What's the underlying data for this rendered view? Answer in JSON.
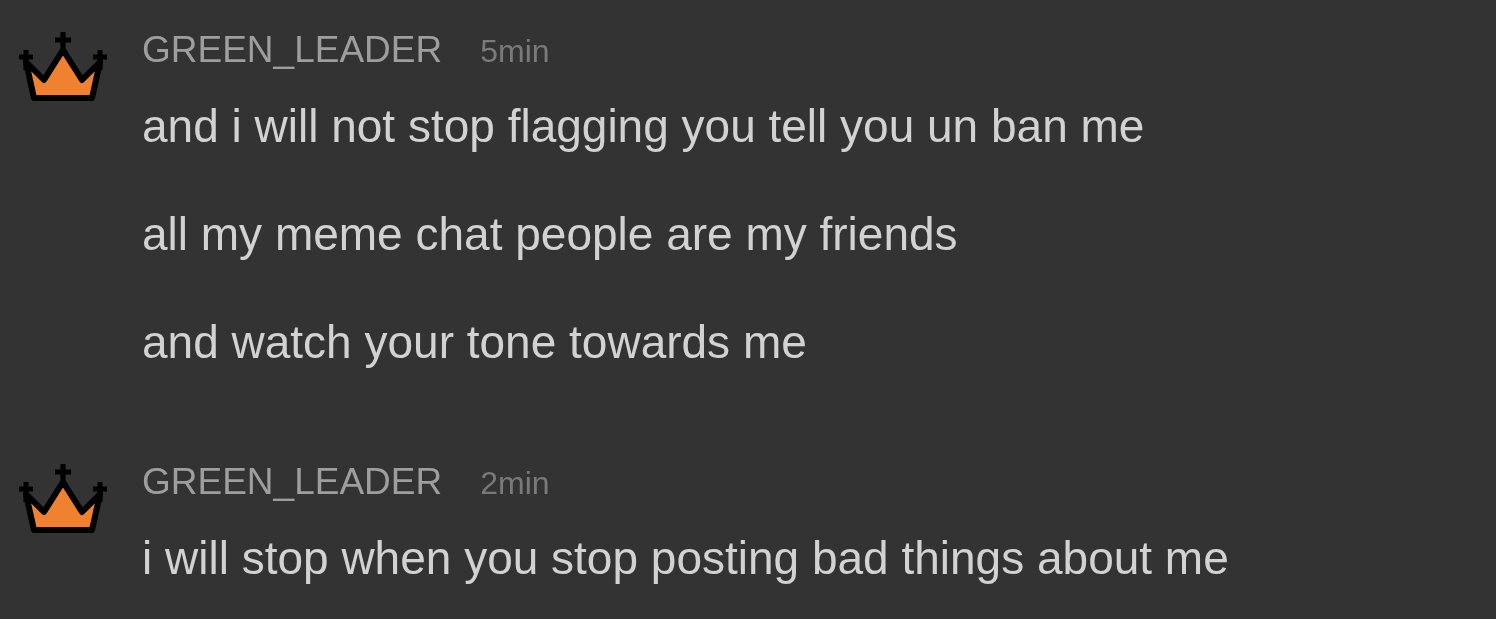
{
  "messages": [
    {
      "author": "GREEN_LEADER",
      "time": "5min",
      "lines": [
        "and i will not stop flagging you tell you un ban me",
        "all my meme chat people are my friends",
        "and watch your tone towards me"
      ]
    },
    {
      "author": "GREEN_LEADER",
      "time": "2min",
      "lines": [
        "i will stop when you stop posting bad things about me"
      ]
    }
  ]
}
